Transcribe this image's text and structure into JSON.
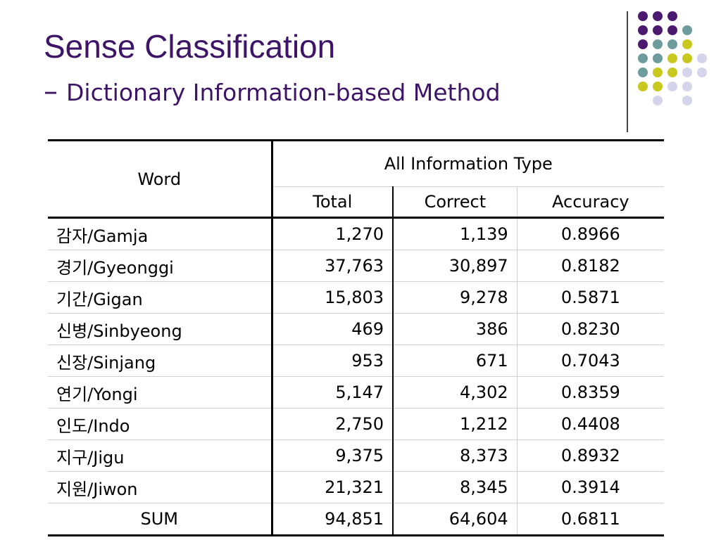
{
  "header": {
    "title": "Sense Classification",
    "subtitle_dash": "–",
    "subtitle": "Dictionary Information-based Method"
  },
  "colors": {
    "title": "#3d1466",
    "purple": "#4b1a6e",
    "teal": "#6e9c9c",
    "olive": "#c8c81e",
    "lavender": "#d4d4ea"
  },
  "table": {
    "headers": {
      "word": "Word",
      "group": "All Information Type",
      "total": "Total",
      "correct": "Correct",
      "accuracy": "Accuracy"
    },
    "rows": [
      {
        "word": "감자/Gamja",
        "total": "1,270",
        "correct": "1,139",
        "accuracy": "0.8966"
      },
      {
        "word": "경기/Gyeonggi",
        "total": "37,763",
        "correct": "30,897",
        "accuracy": "0.8182"
      },
      {
        "word": "기간/Gigan",
        "total": "15,803",
        "correct": "9,278",
        "accuracy": "0.5871"
      },
      {
        "word": "신병/Sinbyeong",
        "total": "469",
        "correct": "386",
        "accuracy": "0.8230"
      },
      {
        "word": "신장/Sinjang",
        "total": "953",
        "correct": "671",
        "accuracy": "0.7043"
      },
      {
        "word": "연기/Yongi",
        "total": "5,147",
        "correct": "4,302",
        "accuracy": "0.8359"
      },
      {
        "word": "인도/Indo",
        "total": "2,750",
        "correct": "1,212",
        "accuracy": "0.4408"
      },
      {
        "word": "지구/Jigu",
        "total": "9,375",
        "correct": "8,373",
        "accuracy": "0.8932"
      },
      {
        "word": "지원/Jiwon",
        "total": "21,321",
        "correct": "8,345",
        "accuracy": "0.3914"
      }
    ],
    "sum": {
      "word": "SUM",
      "total": "94,851",
      "correct": "64,604",
      "accuracy": "0.6811"
    }
  }
}
